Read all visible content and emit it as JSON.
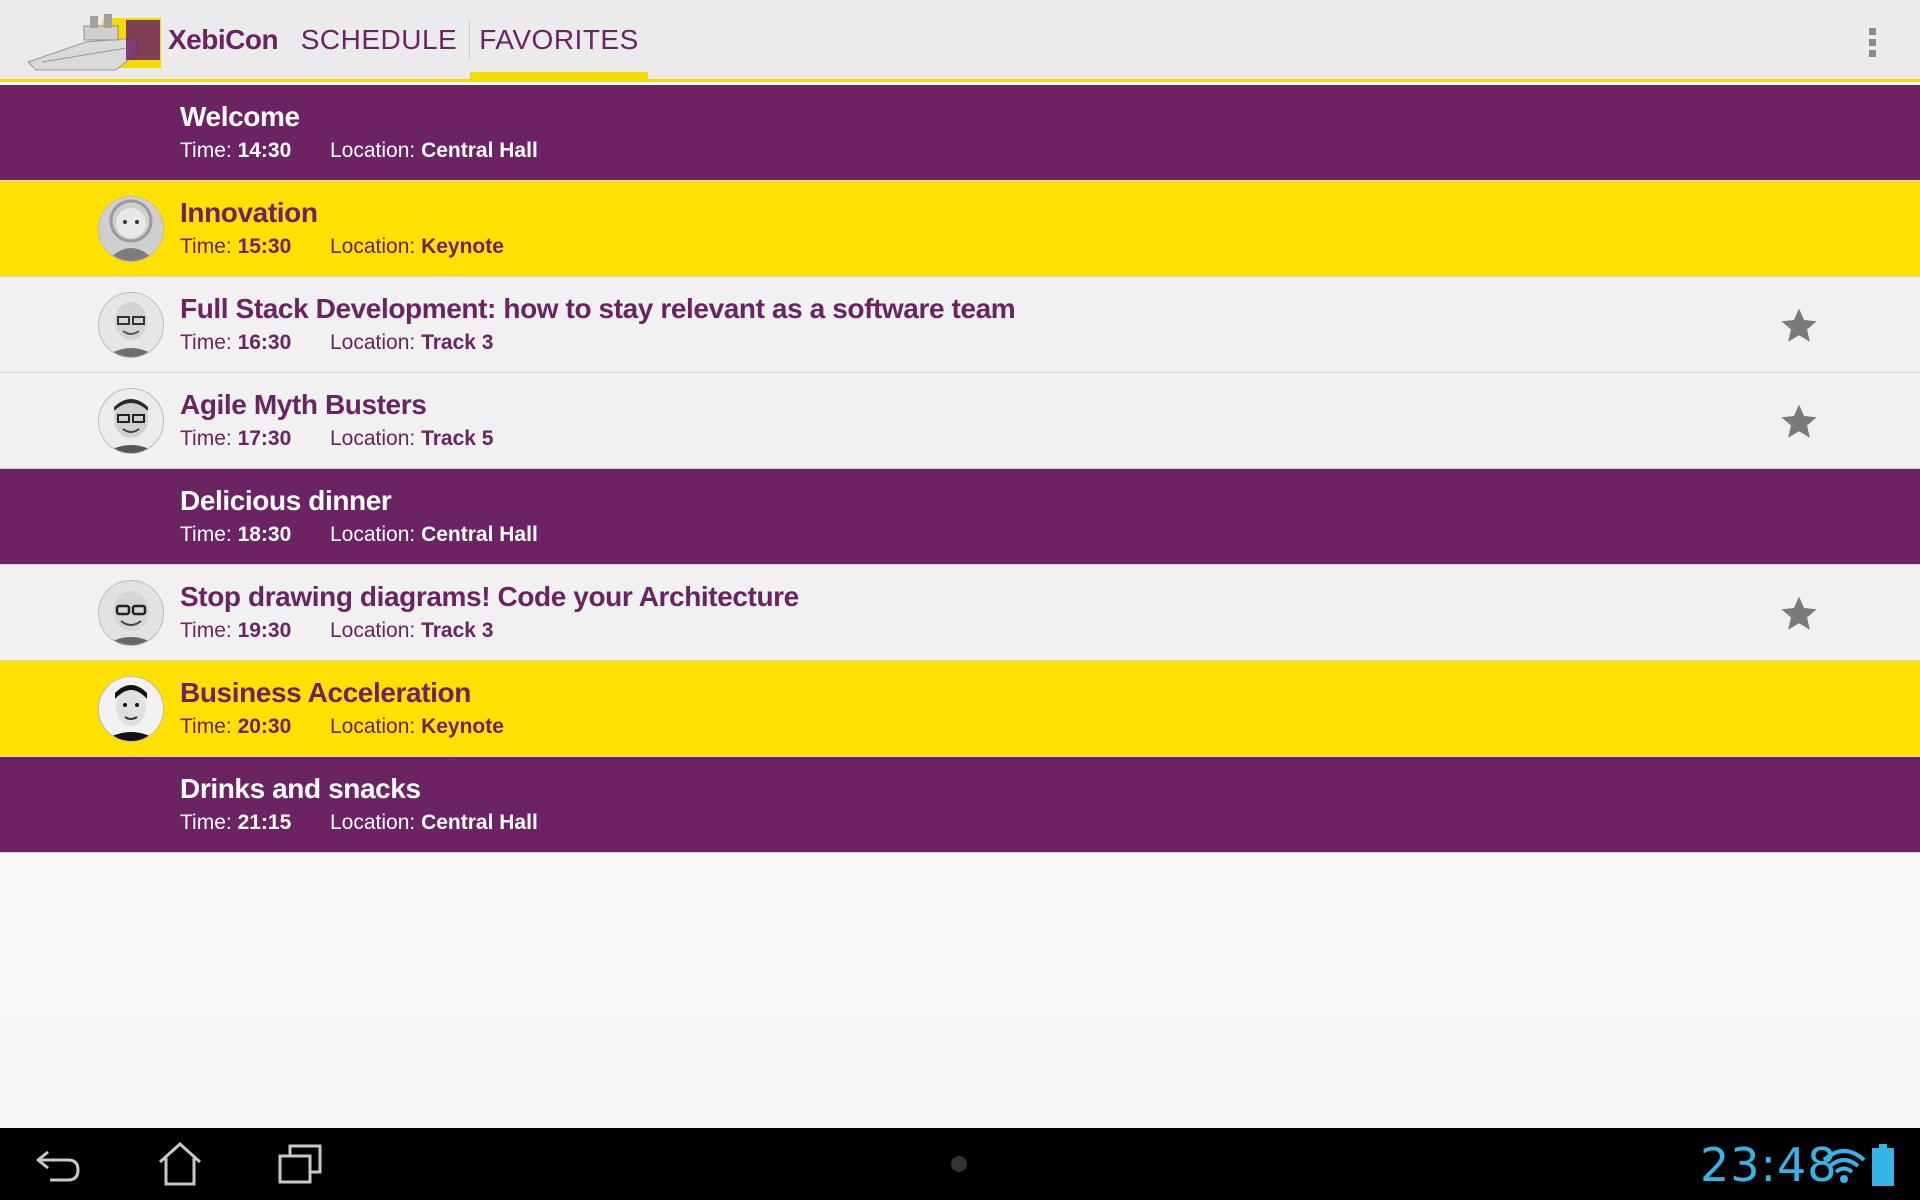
{
  "app": {
    "title": "XebiCon",
    "tabs": [
      {
        "label": "SCHEDULE",
        "selected": false
      },
      {
        "label": "FAVORITES",
        "selected": true
      }
    ]
  },
  "colors": {
    "purple": "#6b2363",
    "yellow": "#ffe100",
    "talk_background": "#f1f1f1",
    "status_blue": "#33b5e5"
  },
  "labels": {
    "time": "Time:",
    "location": "Location:"
  },
  "sessions": [
    {
      "title": "Welcome",
      "time": "14:30",
      "location": "Central Hall",
      "kind": "general",
      "speaker_avatar": false,
      "favorite": false
    },
    {
      "title": "Innovation",
      "time": "15:30",
      "location": "Keynote",
      "kind": "keynote",
      "speaker_avatar": true,
      "favorite": false
    },
    {
      "title": "Full Stack Development: how to stay relevant as a software team",
      "time": "16:30",
      "location": "Track 3",
      "kind": "talk",
      "speaker_avatar": true,
      "favorite": true
    },
    {
      "title": "Agile Myth Busters",
      "time": "17:30",
      "location": "Track 5",
      "kind": "talk",
      "speaker_avatar": true,
      "favorite": true
    },
    {
      "title": "Delicious dinner",
      "time": "18:30",
      "location": "Central Hall",
      "kind": "general",
      "speaker_avatar": false,
      "favorite": false
    },
    {
      "title": "Stop drawing diagrams! Code your Architecture",
      "time": "19:30",
      "location": "Track 3",
      "kind": "talk",
      "speaker_avatar": true,
      "favorite": true
    },
    {
      "title": "Business Acceleration",
      "time": "20:30",
      "location": "Keynote",
      "kind": "keynote",
      "speaker_avatar": true,
      "favorite": false
    },
    {
      "title": "Drinks and snacks",
      "time": "21:15",
      "location": "Central Hall",
      "kind": "general",
      "speaker_avatar": false,
      "favorite": false
    }
  ],
  "icons": {
    "logo": "ship-logo-icon",
    "overflow": "overflow-menu-icon",
    "favorite": "star-icon",
    "back": "back-icon",
    "home": "home-icon",
    "recent": "recent-apps-icon",
    "wifi": "wifi-icon",
    "battery": "battery-icon"
  },
  "status_bar": {
    "clock": "23:48"
  }
}
